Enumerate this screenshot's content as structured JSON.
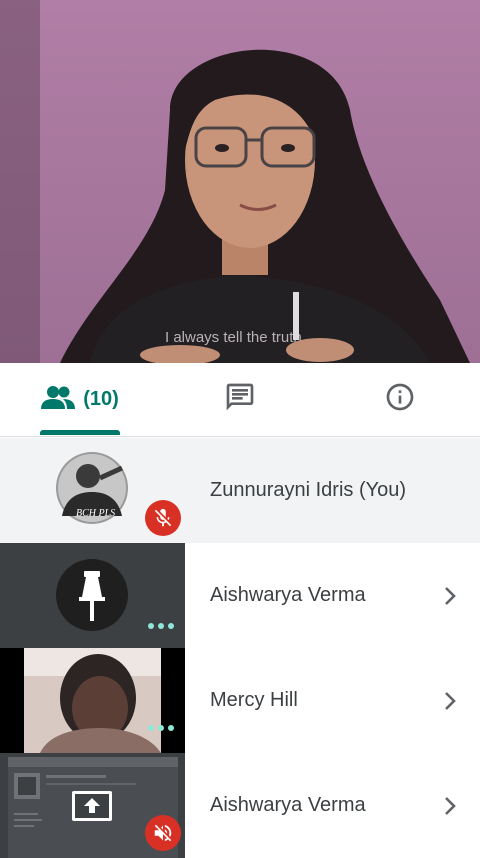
{
  "tabs": {
    "people": {
      "icon": "people-icon",
      "count_label": "(10)"
    },
    "chat": {
      "icon": "chat-icon"
    },
    "info": {
      "icon": "info-icon"
    },
    "active": "people"
  },
  "main_video": {
    "shirt_text": "I always tell the truth"
  },
  "participants": [
    {
      "name": "Zunnurayni Idris (You)",
      "thumb": "avatar",
      "badge": "mic-off-icon",
      "avatar_text": "BCH PLS"
    },
    {
      "name": "Aishwarya Verma",
      "thumb": "pin-icon",
      "badge": "more-dots-icon"
    },
    {
      "name": "Mercy Hill",
      "thumb": "video",
      "badge": "more-dots-icon"
    },
    {
      "name": "Aishwarya Verma",
      "thumb": "screen-share",
      "badge": "volume-off-icon"
    }
  ],
  "colors": {
    "accent": "#00796b",
    "mute_red": "#d93025",
    "dots": "#8ee8da",
    "self_row_bg": "#f1f3f4",
    "tile_bg": "#3c4043"
  }
}
